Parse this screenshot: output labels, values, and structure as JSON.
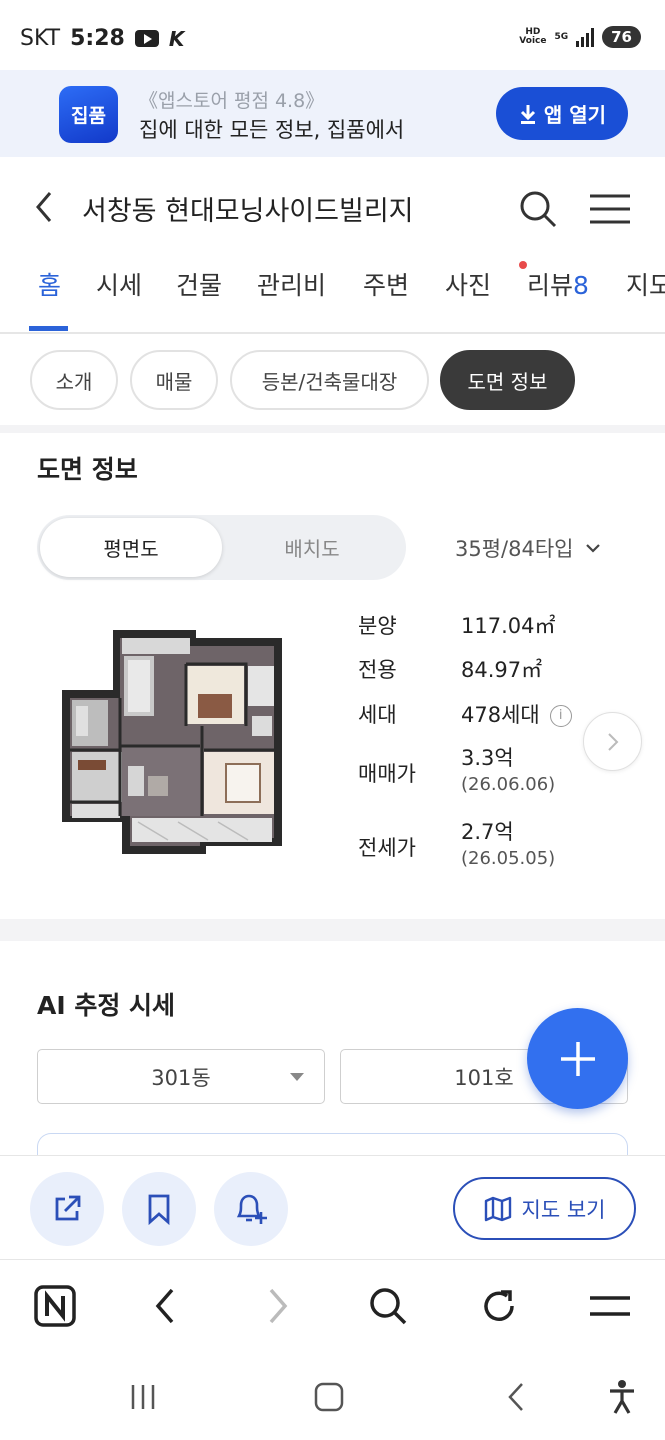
{
  "status_bar": {
    "carrier": "SKT",
    "time": "5:28",
    "hd_voice": "HD Voice",
    "network": "5G",
    "battery": "76"
  },
  "app_banner": {
    "logo_text": "집품",
    "rating": "《앱스토어 평점 4.8》",
    "description": "집에 대한 모든 정보, 집품에서",
    "open_button": "앱 열기",
    "brand_color": "#1a4fd6"
  },
  "header": {
    "title": "서창동 현대모닝사이드빌리지"
  },
  "tabs": [
    {
      "label": "홈",
      "active": true
    },
    {
      "label": "시세"
    },
    {
      "label": "건물"
    },
    {
      "label": "관리비"
    },
    {
      "label": "주변"
    },
    {
      "label": "사진"
    },
    {
      "label": "리뷰",
      "count": "8"
    },
    {
      "label": "지도"
    }
  ],
  "chips": [
    {
      "label": "소개"
    },
    {
      "label": "매물"
    },
    {
      "label": "등본/건축물대장"
    },
    {
      "label": "도면 정보",
      "active": true
    }
  ],
  "floor_section": {
    "title": "도면 정보",
    "toggle": [
      "평면도",
      "배치도"
    ],
    "toggle_selected": 0,
    "type_select": "35평/84타입",
    "info": [
      {
        "label": "분양",
        "value": "117.04㎡"
      },
      {
        "label": "전용",
        "value": "84.97㎡"
      },
      {
        "label": "세대",
        "value": "478세대"
      },
      {
        "label": "매매가",
        "value": "3.3억",
        "date": "(26.06.06)"
      },
      {
        "label": "전세가",
        "value": "2.7억",
        "date": "(26.05.05)"
      }
    ]
  },
  "ai_section": {
    "title": "AI 추정 시세",
    "building_select": "301동",
    "unit_select": "101호"
  },
  "bottom_actions": {
    "map_button": "지도 보기"
  },
  "icons": {
    "share": "share-icon",
    "bookmark": "bookmark-icon",
    "alert": "bell-add-icon",
    "map": "map-icon"
  },
  "accent_color": "#2b63d9"
}
